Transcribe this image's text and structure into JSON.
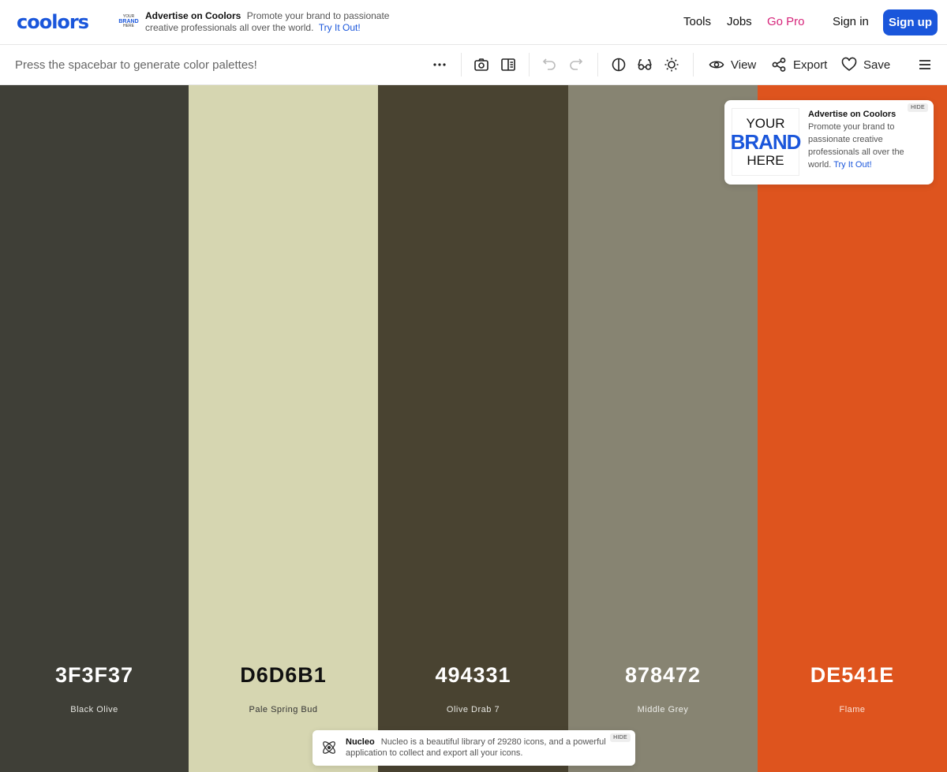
{
  "header": {
    "logo": "coolors",
    "ad_logo": {
      "line1": "YOUR",
      "line2": "BRAND",
      "line3": "HERE"
    },
    "ad_title": "Advertise on Coolors",
    "ad_text": "Promote your brand to passionate creative professionals all over the world.",
    "ad_link": "Try It Out!",
    "nav": {
      "tools": "Tools",
      "jobs": "Jobs",
      "go_pro": "Go Pro",
      "sign_in": "Sign in",
      "sign_up": "Sign up"
    }
  },
  "toolbar": {
    "hint": "Press the spacebar to generate color palettes!",
    "view": "View",
    "export": "Export",
    "save": "Save",
    "icons": [
      "more-icon",
      "camera-icon",
      "split-view-icon",
      "undo-icon",
      "redo-icon",
      "contrast-icon",
      "glasses-icon",
      "brightness-icon",
      "eye-icon",
      "share-icon",
      "heart-icon",
      "menu-icon"
    ]
  },
  "palette": [
    {
      "hex": "3F3F37",
      "name": "Black Olive",
      "color": "#3F3F37",
      "text_color": "#FFFFFF",
      "name_color": "#E6E6E1"
    },
    {
      "hex": "D6D6B1",
      "name": "Pale Spring Bud",
      "color": "#D6D6B1",
      "text_color": "#111111",
      "name_color": "#333333"
    },
    {
      "hex": "494331",
      "name": "Olive Drab 7",
      "color": "#494331",
      "text_color": "#FFFFFF",
      "name_color": "#E6E6E1"
    },
    {
      "hex": "878472",
      "name": "Middle Grey",
      "color": "#878472",
      "text_color": "#FFFFFF",
      "name_color": "#EEEEEA"
    },
    {
      "hex": "DE541E",
      "name": "Flame",
      "color": "#DE541E",
      "text_color": "#FFFFFF",
      "name_color": "#FBE3D8"
    }
  ],
  "ad_card": {
    "brand_line1": "YOUR",
    "brand_line2": "BRAND",
    "brand_line3": "HERE",
    "title": "Advertise on Coolors",
    "text": "Promote your brand to passionate creative professionals all over the world.",
    "link": "Try It Out!",
    "hide": "HIDE"
  },
  "ad_bottom": {
    "title": "Nucleo",
    "text": "Nucleo is a beautiful library of 29280 icons, and a powerful application to collect and export all your icons.",
    "hide": "HIDE"
  }
}
